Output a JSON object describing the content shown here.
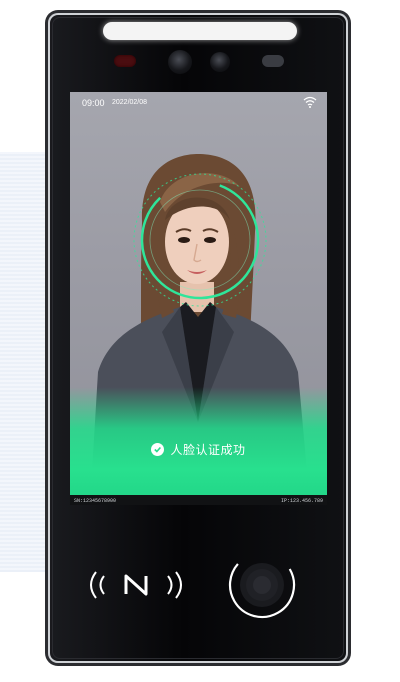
{
  "status_bar": {
    "time": "09:00",
    "date": "2022/02/08"
  },
  "icons": {
    "wifi": "wifi-icon",
    "check": "check-circle-icon",
    "nfc": "nfc-icon",
    "fingerprint": "fingerprint-sensor-icon"
  },
  "recognition": {
    "message": "人脸认证成功",
    "ring_color": "#2fe59a",
    "overlay_color": "#24dd8c"
  },
  "footer": {
    "serial": "SN:12345678900",
    "ip": "IP:123.456.789"
  }
}
